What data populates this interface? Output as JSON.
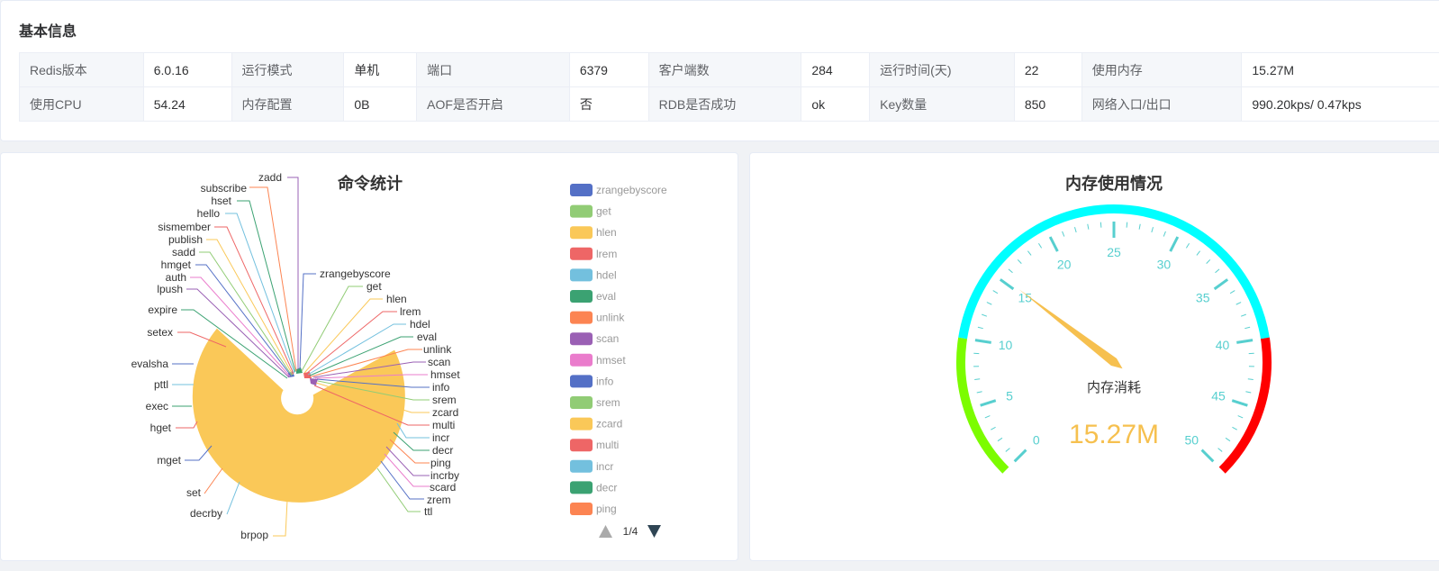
{
  "basic": {
    "title": "基本信息",
    "rows": [
      [
        {
          "label": "Redis版本",
          "value": "6.0.16"
        },
        {
          "label": "运行模式",
          "value": "单机"
        },
        {
          "label": "端口",
          "value": "6379"
        },
        {
          "label": "客户端数",
          "value": "284"
        },
        {
          "label": "运行时间(天)",
          "value": "22"
        },
        {
          "label": "使用内存",
          "value": "15.27M"
        }
      ],
      [
        {
          "label": "使用CPU",
          "value": "54.24"
        },
        {
          "label": "内存配置",
          "value": "0B"
        },
        {
          "label": "AOF是否开启",
          "value": "否"
        },
        {
          "label": "RDB是否成功",
          "value": "ok"
        },
        {
          "label": "Key数量",
          "value": "850"
        },
        {
          "label": "网络入口/出口",
          "value": "990.20kps/ 0.47kps"
        }
      ]
    ]
  },
  "commands": {
    "title": "命令统计",
    "pager": "1/4",
    "legend": [
      {
        "name": "zrangebyscore",
        "color": "#5470c6"
      },
      {
        "name": "get",
        "color": "#91cc75"
      },
      {
        "name": "hlen",
        "color": "#fac858"
      },
      {
        "name": "lrem",
        "color": "#ee6666"
      },
      {
        "name": "hdel",
        "color": "#73c0de"
      },
      {
        "name": "eval",
        "color": "#3ba272"
      },
      {
        "name": "unlink",
        "color": "#fc8452"
      },
      {
        "name": "scan",
        "color": "#9a60b4"
      },
      {
        "name": "hmset",
        "color": "#ea7ccc"
      },
      {
        "name": "info",
        "color": "#5470c6"
      },
      {
        "name": "srem",
        "color": "#91cc75"
      },
      {
        "name": "zcard",
        "color": "#fac858"
      },
      {
        "name": "multi",
        "color": "#ee6666"
      },
      {
        "name": "incr",
        "color": "#73c0de"
      },
      {
        "name": "decr",
        "color": "#3ba272"
      },
      {
        "name": "ping",
        "color": "#fc8452"
      }
    ],
    "pie_labels": {
      "zadd": "zadd",
      "subscribe": "subscribe",
      "hset": "hset",
      "hello": "hello",
      "sismember": "sismember",
      "publish": "publish",
      "sadd": "sadd",
      "hmget": "hmget",
      "auth": "auth",
      "lpush": "lpush",
      "expire": "expire",
      "setex": "setex",
      "evalsha": "evalsha",
      "pttl": "pttl",
      "exec": "exec",
      "hget": "hget",
      "mget": "mget",
      "set": "set",
      "decrby": "decrby",
      "brpop": "brpop",
      "zrangebyscore": "zrangebyscore",
      "get": "get",
      "hlen": "hlen",
      "lrem": "lrem",
      "hdel": "hdel",
      "eval": "eval",
      "unlink": "unlink",
      "scan": "scan",
      "hmset": "hmset",
      "info": "info",
      "srem": "srem",
      "zcard": "zcard",
      "multi": "multi",
      "incr": "incr",
      "decr": "decr",
      "ping": "ping",
      "incrby": "incrby",
      "scard": "scard",
      "zrem": "zrem",
      "ttl": "ttl"
    }
  },
  "memory": {
    "title": "内存使用情况",
    "gauge_name": "内存消耗",
    "gauge_value_text": "15.27M",
    "gauge_value": 15.27,
    "gauge_min": 0,
    "gauge_max": 50,
    "tick_labels": [
      "0",
      "5",
      "10",
      "15",
      "20",
      "25",
      "30",
      "35",
      "40",
      "45",
      "50"
    ],
    "colors": {
      "low": "#7cfc00",
      "mid": "#00ffff",
      "high": "#ff0000",
      "tick": "#57cfcf",
      "pointer": "#f6c04f"
    }
  }
}
